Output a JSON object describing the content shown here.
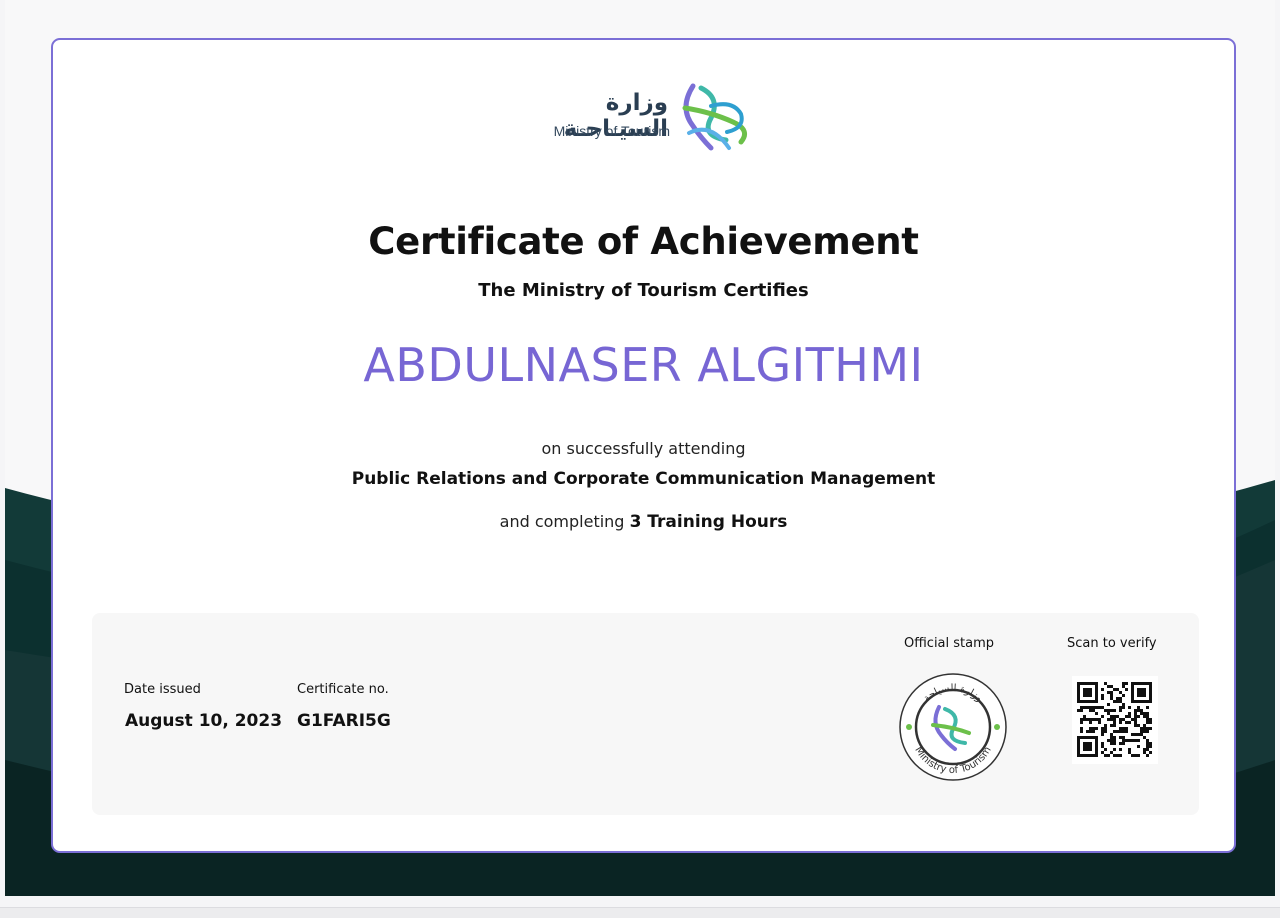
{
  "logo": {
    "arabic": "وزارة السيـاحـة",
    "english": "Ministry of Tourism"
  },
  "certificate": {
    "title": "Certificate of Achievement",
    "subtitle": "The Ministry of Tourism Certifies",
    "recipient": "ABDULNASER ALGITHMI",
    "attending_text": "on successfully attending",
    "course": "Public Relations and Corporate Communication Management",
    "completing_text": "and completing",
    "hours": "3 Training Hours"
  },
  "footer": {
    "date_label": "Date issued",
    "date_value": "August 10, 2023",
    "cert_no_label": "Certificate no.",
    "cert_no_value": "G1FARI5G",
    "stamp_label": "Official stamp",
    "stamp_text_top": "وزارة السياحة",
    "stamp_text_bottom": "Ministry of Tourism",
    "verify_label": "Scan to verify"
  },
  "colors": {
    "accent": "#7b6fd6",
    "recipient": "#7766d4",
    "background_wave": "#0f3a3a"
  }
}
